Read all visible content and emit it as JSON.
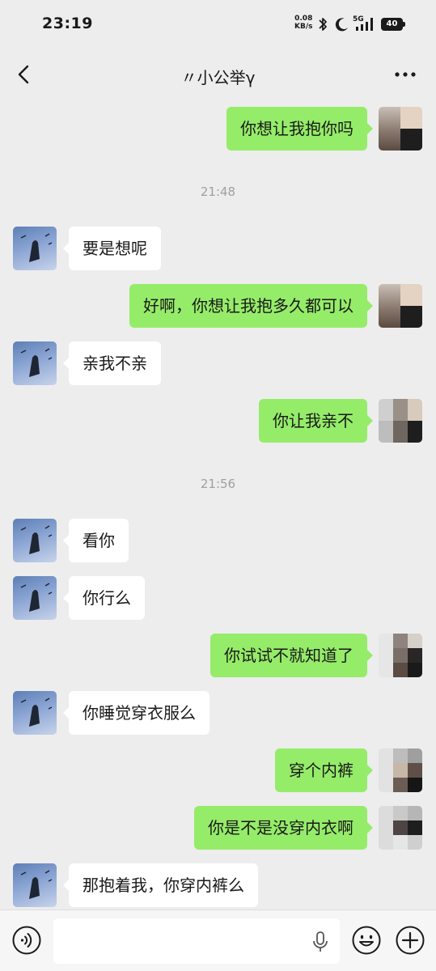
{
  "status_bar": {
    "time": "23:19",
    "net_speed_value": "0.08",
    "net_speed_unit": "KB/s",
    "network": "5G",
    "battery": "40"
  },
  "header": {
    "title": "〃小公举γ"
  },
  "timestamps": [
    "21:48",
    "21:56"
  ],
  "messages": [
    {
      "side": "out",
      "text": "你想让我抱你吗"
    },
    {
      "side": "in",
      "text": "要是想呢"
    },
    {
      "side": "out",
      "text": "好啊，你想让我抱多久都可以"
    },
    {
      "side": "in",
      "text": "亲我不亲"
    },
    {
      "side": "out",
      "text": "你让我亲不"
    },
    {
      "side": "in",
      "text": "看你"
    },
    {
      "side": "in",
      "text": "你行么"
    },
    {
      "side": "out",
      "text": "你试试不就知道了"
    },
    {
      "side": "in",
      "text": "你睡觉穿衣服么"
    },
    {
      "side": "out",
      "text": "穿个内裤"
    },
    {
      "side": "out",
      "text": "你是不是没穿内衣啊"
    },
    {
      "side": "in",
      "text": "那抱着我，你穿内裤么"
    }
  ],
  "icons": {
    "back": "chevron-left-icon",
    "more": "more-dots-icon",
    "voice": "voice-icon",
    "mic": "mic-icon",
    "emoji": "emoji-icon",
    "plus": "plus-icon"
  },
  "colors": {
    "background": "#ededed",
    "outgoing_bubble": "#95ec69",
    "incoming_bubble": "#ffffff",
    "timestamp": "#a0a0a0"
  }
}
